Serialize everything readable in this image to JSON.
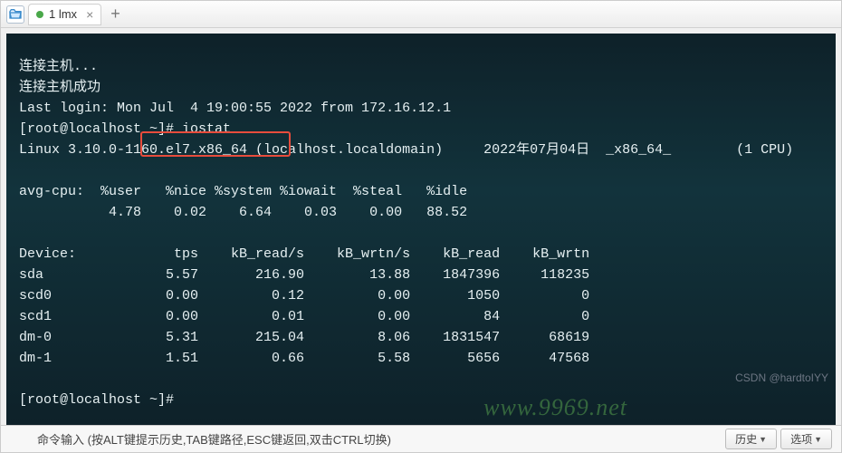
{
  "tab": {
    "label": "1 lmx"
  },
  "terminal": {
    "lines": [
      "连接主机...",
      "连接主机成功",
      "Last login: Mon Jul  4 19:00:55 2022 from 172.16.12.1",
      "[root@localhost ~]# iostat",
      "Linux 3.10.0-1160.el7.x86_64 (localhost.localdomain)     2022年07月04日  _x86_64_        (1 CPU)",
      "",
      "avg-cpu:  %user   %nice %system %iowait  %steal   %idle",
      "           4.78    0.02    6.64    0.03    0.00   88.52",
      "",
      "Device:            tps    kB_read/s    kB_wrtn/s    kB_read    kB_wrtn",
      "sda               5.57       216.90        13.88    1847396     118235",
      "scd0              0.00         0.12         0.00       1050          0",
      "scd1              0.00         0.01         0.00         84          0",
      "dm-0              5.31       215.04         8.06    1831547      68619",
      "dm-1              1.51         0.66         5.58       5656      47568",
      "",
      "[root@localhost ~]#"
    ],
    "command": "iostat",
    "system_line": "Linux 3.10.0-1160.el7.x86_64 (localhost.localdomain)     2022年07月04日  _x86_64_        (1 CPU)",
    "cpu_headers": [
      "%user",
      "%nice",
      "%system",
      "%iowait",
      "%steal",
      "%idle"
    ],
    "cpu_values": [
      4.78,
      0.02,
      6.64,
      0.03,
      0.0,
      88.52
    ],
    "device_headers": [
      "Device:",
      "tps",
      "kB_read/s",
      "kB_wrtn/s",
      "kB_read",
      "kB_wrtn"
    ],
    "devices": [
      {
        "name": "sda",
        "tps": 5.57,
        "kB_read_s": 216.9,
        "kB_wrtn_s": 13.88,
        "kB_read": 1847396,
        "kB_wrtn": 118235
      },
      {
        "name": "scd0",
        "tps": 0.0,
        "kB_read_s": 0.12,
        "kB_wrtn_s": 0.0,
        "kB_read": 1050,
        "kB_wrtn": 0
      },
      {
        "name": "scd1",
        "tps": 0.0,
        "kB_read_s": 0.01,
        "kB_wrtn_s": 0.0,
        "kB_read": 84,
        "kB_wrtn": 0
      },
      {
        "name": "dm-0",
        "tps": 5.31,
        "kB_read_s": 215.04,
        "kB_wrtn_s": 8.06,
        "kB_read": 1831547,
        "kB_wrtn": 68619
      },
      {
        "name": "dm-1",
        "tps": 1.51,
        "kB_read_s": 0.66,
        "kB_wrtn_s": 5.58,
        "kB_read": 5656,
        "kB_wrtn": 47568
      }
    ]
  },
  "bottombar": {
    "hint": "命令输入 (按ALT键提示历史,TAB键路径,ESC键返回,双击CTRL切换)",
    "btn_history": "历史",
    "btn_options": "选项"
  },
  "watermarks": {
    "csdn": "CSDN @hardtoIYY",
    "site": "www.9969.net"
  }
}
